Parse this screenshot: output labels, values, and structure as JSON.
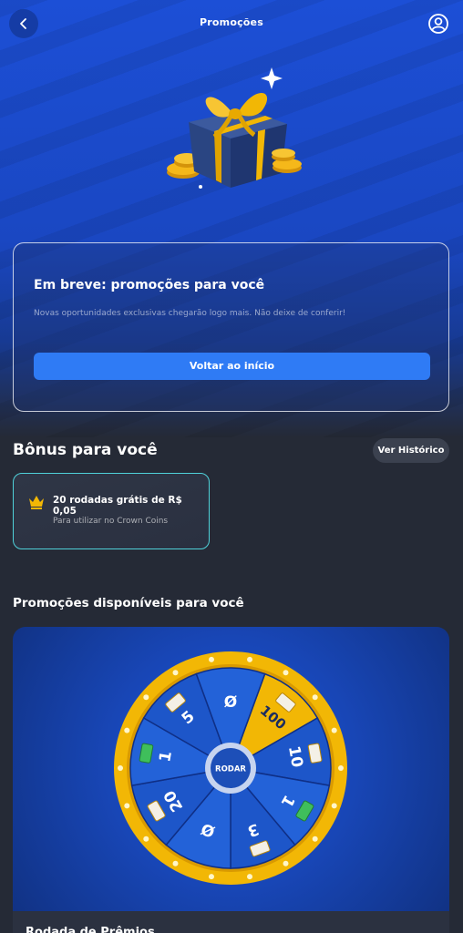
{
  "header": {
    "title": "Promoções",
    "back_icon": "chevron-left-icon",
    "account_icon": "user-circle-icon"
  },
  "empty_state": {
    "title": "Em breve: promoções para você",
    "description": "Novas oportunidades exclusivas chegarão logo mais. Não deixe de conferir!",
    "button_label": "Voltar ao início"
  },
  "bonus": {
    "heading": "Bônus para você",
    "history_label": "Ver Histórico",
    "items": [
      {
        "icon": "crown-icon",
        "title": "20 rodadas grátis de R$ 0,05",
        "subtitle": "Para utilizar no Crown Coins"
      }
    ]
  },
  "promotions": {
    "heading": "Promoções disponíveis para você",
    "cards": [
      {
        "name": "Rodada de Prêmios",
        "wheel": {
          "center_label": "RODAR",
          "segments": [
            {
              "label": "100",
              "icon": "slot-icon",
              "highlight": true
            },
            {
              "label": "10",
              "icon": "slot-icon"
            },
            {
              "label": "1",
              "icon": "cash-icon"
            },
            {
              "label": "3",
              "icon": "slot-icon"
            },
            {
              "label": "Ø",
              "icon": ""
            },
            {
              "label": "20",
              "icon": "slot-icon"
            },
            {
              "label": "1",
              "icon": "cash-icon"
            },
            {
              "label": "5",
              "icon": "slot-icon"
            },
            {
              "label": "Ø",
              "icon": ""
            }
          ]
        }
      }
    ]
  },
  "colors": {
    "accent": "#2f7bf5",
    "bonus_border": "#4fd1d9",
    "wheel_gold": "#f2b705",
    "wheel_blue": "#1d56c9",
    "background": "#252a36"
  }
}
